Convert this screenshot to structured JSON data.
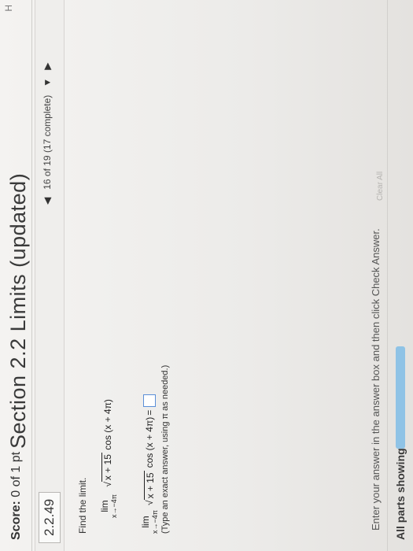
{
  "header": {
    "title": "Section 2.2 Limits (updated)",
    "edge_letter": "H"
  },
  "score": {
    "label": "Score:",
    "value": "0 of 1 pt"
  },
  "question": {
    "number": "2.2.49",
    "progress_text": "16 of 19 (17 complete)",
    "prev_symbol": "◀",
    "next_symbol": "▶",
    "dropdown_symbol": "▼"
  },
  "problem": {
    "prompt": "Find the limit.",
    "lim_word": "lim",
    "lim_sub": "x→−4π",
    "sqrt_symbol": "√",
    "radicand": "x + 15",
    "cos_part": "cos (x + 4π)",
    "equals": "=",
    "hint": "(Type an exact answer, using π as needed.)"
  },
  "footer": {
    "message": "Enter your answer in the answer box and then click Check Answer.",
    "parts_label": "All parts showing",
    "clear_all": "Clear All"
  },
  "colors": {
    "progress": "#8fc3e6",
    "answer_border": "#5b8fd8"
  }
}
